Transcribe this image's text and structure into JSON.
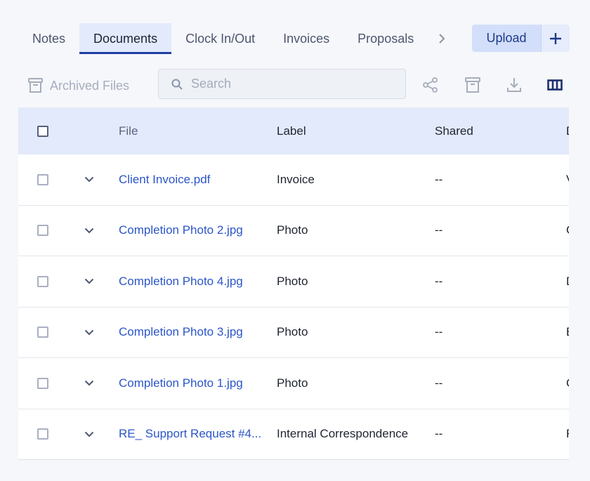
{
  "tabs": [
    {
      "label": "Notes",
      "active": false
    },
    {
      "label": "Documents",
      "active": true
    },
    {
      "label": "Clock In/Out",
      "active": false
    },
    {
      "label": "Invoices",
      "active": false
    },
    {
      "label": "Proposals",
      "active": false
    }
  ],
  "toolbar": {
    "upload_label": "Upload",
    "archived_label": "Archived Files",
    "search_placeholder": "Search"
  },
  "table": {
    "headers": {
      "file": "File",
      "label": "Label",
      "shared": "Shared",
      "extra": "D"
    },
    "rows": [
      {
        "file": "Client Invoice.pdf",
        "label": "Invoice",
        "shared": "--",
        "extra": "V"
      },
      {
        "file": "Completion Photo 2.jpg",
        "label": "Photo",
        "shared": "--",
        "extra": "C"
      },
      {
        "file": "Completion Photo 4.jpg",
        "label": "Photo",
        "shared": "--",
        "extra": "D"
      },
      {
        "file": "Completion Photo 3.jpg",
        "label": "Photo",
        "shared": "--",
        "extra": "E"
      },
      {
        "file": "Completion Photo 1.jpg",
        "label": "Photo",
        "shared": "--",
        "extra": "C"
      },
      {
        "file": "RE_ Support Request #4...",
        "label": "Internal Correspondence",
        "shared": "--",
        "extra": "F"
      }
    ]
  },
  "icons": {
    "tabs_more": "chevron-right-icon",
    "add": "plus-icon",
    "archive": "archive-box-icon",
    "search": "search-icon",
    "share": "share-icon",
    "download": "download-icon",
    "columns": "columns-icon",
    "row_expand": "chevron-down-icon"
  },
  "colors": {
    "accent": "#1f3fa3",
    "link": "#2b56c8",
    "header_bg": "#e3eafb",
    "upload_bg": "#d3dffa"
  }
}
